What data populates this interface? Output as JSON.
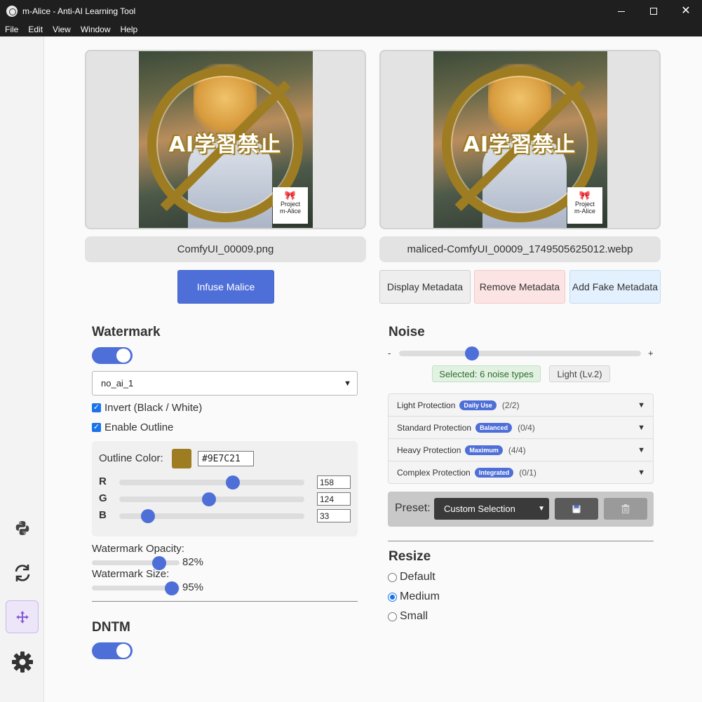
{
  "window": {
    "title": "m-Alice - Anti-AI Learning Tool"
  },
  "menu": [
    "File",
    "Edit",
    "View",
    "Window",
    "Help"
  ],
  "sidebar": {
    "items": [
      {
        "icon": "python-icon"
      },
      {
        "icon": "refresh-icon"
      },
      {
        "icon": "move-icon",
        "active": true
      },
      {
        "icon": "gear-icon"
      }
    ]
  },
  "images": {
    "watermark_text": "AI学習禁止",
    "logo_line1": "Project",
    "logo_line2": "m-Alice",
    "input_filename": "ComfyUI_00009.png",
    "output_filename": "maliced-ComfyUI_00009_1749505625012.webp"
  },
  "actions": {
    "infuse": "Infuse Malice",
    "display_metadata": "Display Metadata",
    "remove_metadata": "Remove Metadata",
    "add_fake_metadata": "Add Fake Metadata"
  },
  "watermark": {
    "title": "Watermark",
    "enabled": true,
    "select_value": "no_ai_1",
    "invert_label": "Invert (Black / White)",
    "outline_label": "Enable Outline",
    "outline_color_label": "Outline Color:",
    "outline_color_hex": "#9E7C21",
    "outline_color": "#9e7c21",
    "r_label": "R",
    "g_label": "G",
    "b_label": "B",
    "r": "158",
    "g": "124",
    "b": "33",
    "opacity_label": "Watermark Opacity:",
    "opacity_value": "82%",
    "size_label": "Watermark Size:",
    "size_value": "95%"
  },
  "dntm": {
    "title": "DNTM",
    "enabled": true
  },
  "noise": {
    "title": "Noise",
    "minus": "-",
    "plus": "+",
    "level_fraction": 0.3,
    "selected_label": "Selected: 6 noise types",
    "level_label": "Light (Lv.2)",
    "groups": [
      {
        "name": "Light Protection",
        "badge": "Daily Use",
        "count": "(2/2)"
      },
      {
        "name": "Standard Protection",
        "badge": "Balanced",
        "count": "(0/4)"
      },
      {
        "name": "Heavy Protection",
        "badge": "Maximum",
        "count": "(4/4)"
      },
      {
        "name": "Complex Protection",
        "badge": "Integrated",
        "count": "(0/1)"
      }
    ],
    "preset_label": "Preset:",
    "preset_value": "Custom Selection"
  },
  "resize": {
    "title": "Resize",
    "options": [
      "Default",
      "Medium",
      "Small"
    ],
    "selected": "Medium"
  },
  "colors": {
    "accent": "#4f6fd8",
    "title_bar": "#1f1f1f"
  }
}
